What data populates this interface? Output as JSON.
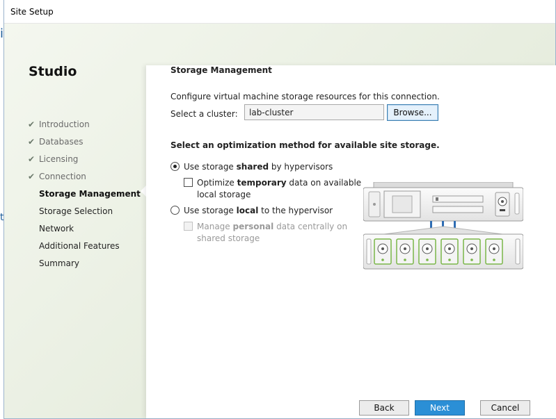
{
  "window": {
    "title": "Site Setup"
  },
  "sidebar": {
    "title": "Studio",
    "steps": [
      {
        "label": "Introduction",
        "state": "done"
      },
      {
        "label": "Databases",
        "state": "done"
      },
      {
        "label": "Licensing",
        "state": "done"
      },
      {
        "label": "Connection",
        "state": "done"
      },
      {
        "label": "Storage Management",
        "state": "current"
      },
      {
        "label": "Storage Selection",
        "state": "pending"
      },
      {
        "label": "Network",
        "state": "pending"
      },
      {
        "label": "Additional Features",
        "state": "pending"
      },
      {
        "label": "Summary",
        "state": "pending"
      }
    ]
  },
  "main": {
    "section_title": "Storage Management",
    "intro": "Configure virtual machine storage resources for this connection.",
    "cluster_label": "Select a cluster:",
    "cluster_value": "lab-cluster",
    "browse_label": "Browse...",
    "optimization_title": "Select an optimization method for available site storage.",
    "shared_option": {
      "prefix": "Use storage ",
      "bold": "shared",
      "suffix": " by hypervisors",
      "selected": true
    },
    "temp_option": {
      "prefix": "Optimize ",
      "bold": "temporary",
      "suffix": " data on available",
      "line2": "local storage",
      "checked": false
    },
    "local_option": {
      "prefix": "Use storage ",
      "bold": "local",
      "suffix": " to the hypervisor",
      "selected": false
    },
    "personal_option": {
      "prefix": "Manage ",
      "bold": "personal",
      "suffix": " data centrally on",
      "line2": "shared storage",
      "checked": false,
      "disabled": true
    }
  },
  "footer": {
    "back": "Back",
    "next": "Next",
    "cancel": "Cancel"
  },
  "colors": {
    "accent": "#2b8fd6",
    "disk_green": "#7ab648",
    "connector_blue": "#2f6db3"
  }
}
